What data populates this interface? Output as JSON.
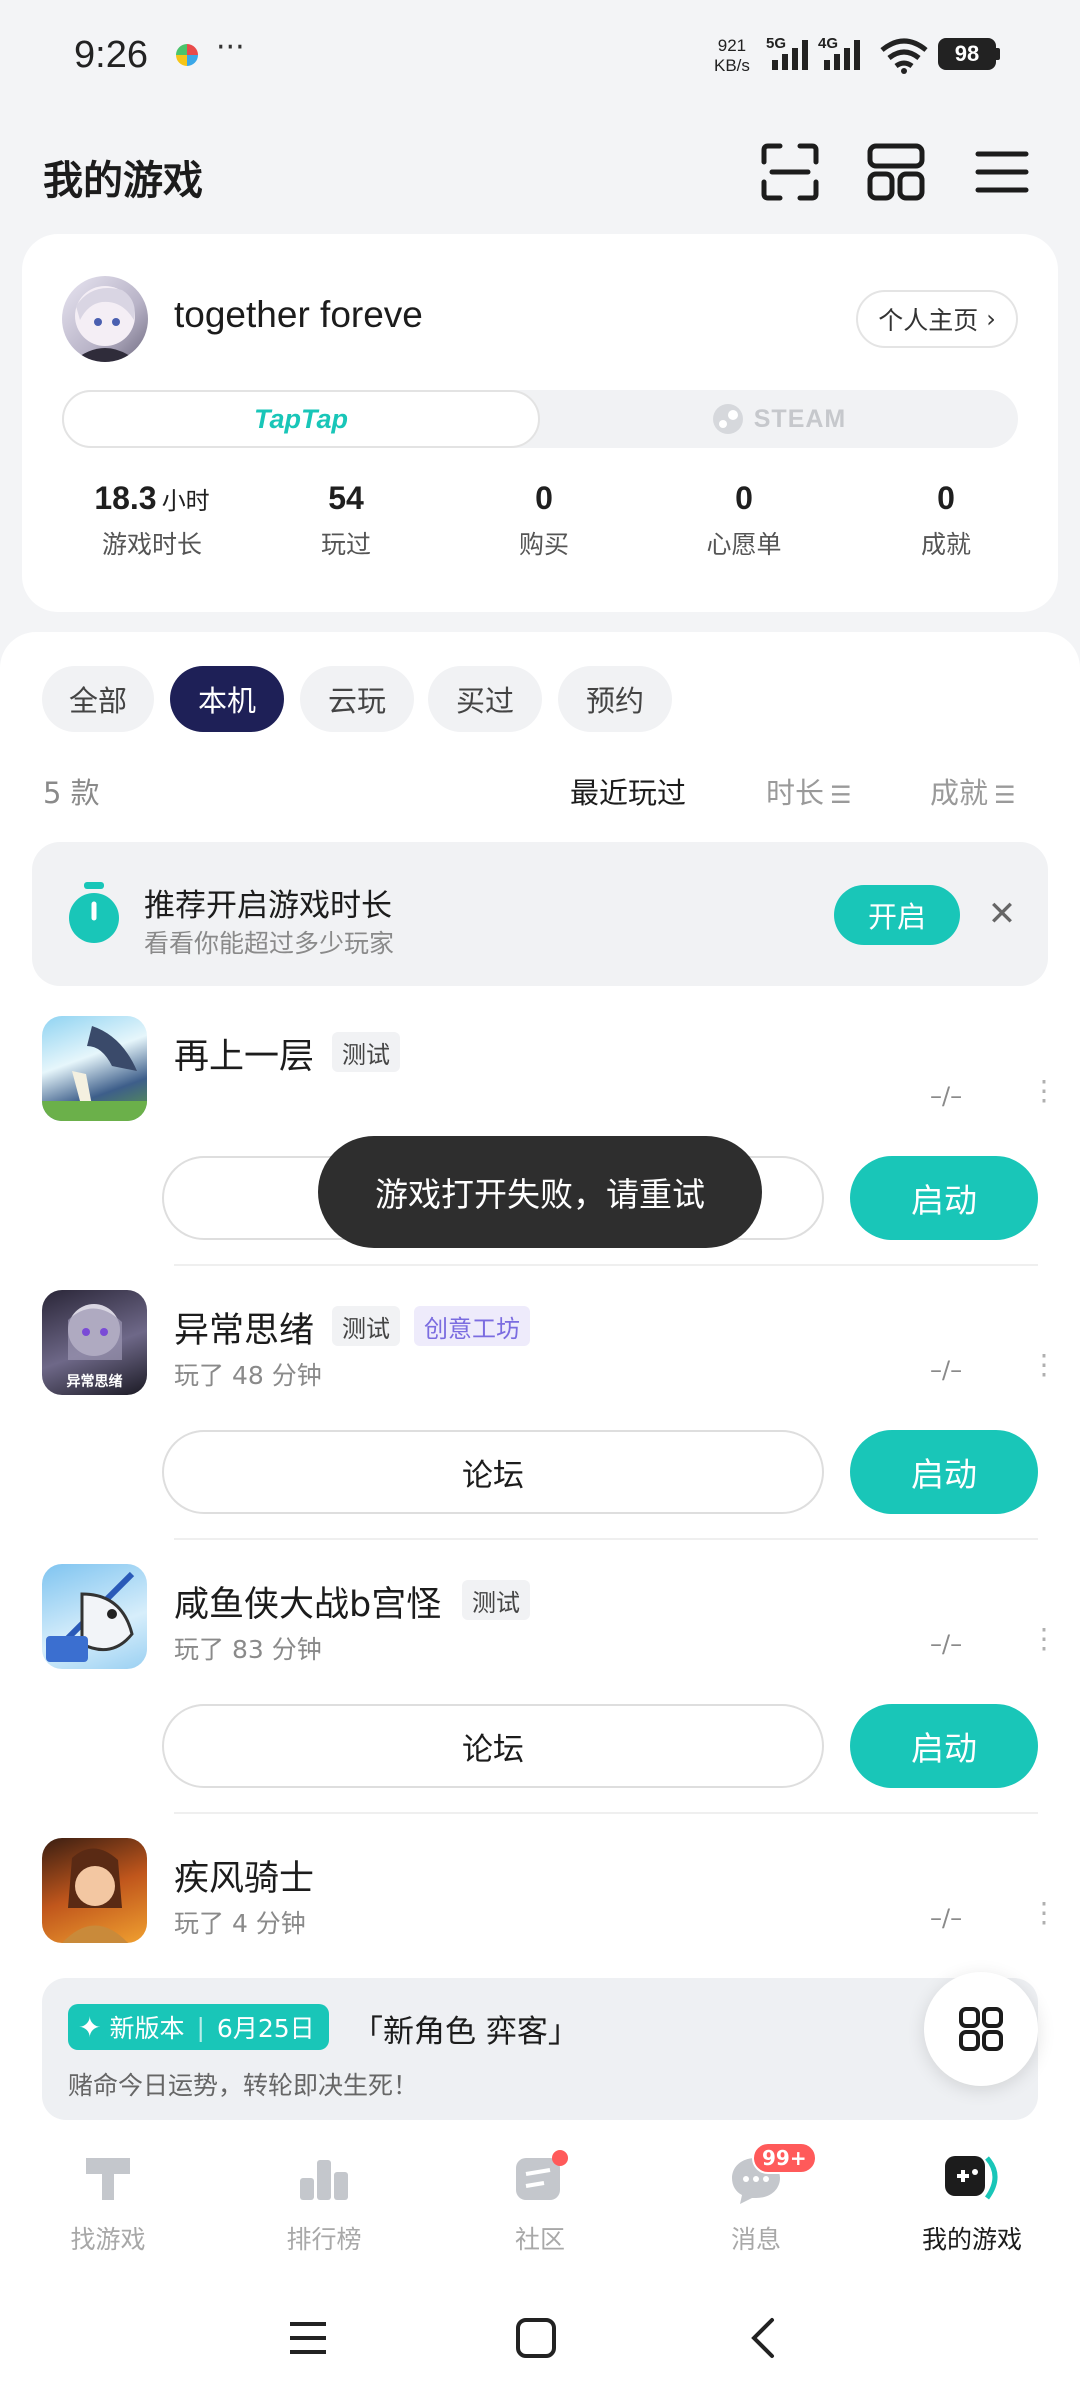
{
  "status": {
    "time": "9:26",
    "net_speed_top": "921",
    "net_speed_unit": "KB/s",
    "sig1": "5G",
    "sig2": "4G",
    "battery": "98"
  },
  "header": {
    "title": "我的游戏"
  },
  "profile": {
    "username": "together foreve",
    "home_button": "个人主页",
    "platforms": [
      "TapTap",
      "STEAM"
    ],
    "stats": [
      {
        "value": "18.3",
        "unit": "小时",
        "label": "游戏时长"
      },
      {
        "value": "54",
        "unit": "",
        "label": "玩过"
      },
      {
        "value": "0",
        "unit": "",
        "label": "购买"
      },
      {
        "value": "0",
        "unit": "",
        "label": "心愿单"
      },
      {
        "value": "0",
        "unit": "",
        "label": "成就"
      }
    ]
  },
  "filters": {
    "chips": [
      "全部",
      "本机",
      "云玩",
      "买过",
      "预约"
    ],
    "active": "本机"
  },
  "list_meta": {
    "count": "5 款",
    "sort_recent": "最近玩过",
    "sort_duration": "时长",
    "sort_achieve": "成就"
  },
  "banner": {
    "title": "推荐开启游戏时长",
    "subtitle": "看看你能超过多少玩家",
    "button": "开启"
  },
  "games": [
    {
      "name": "再上一层",
      "tags": [
        "测试"
      ],
      "playtime": "",
      "rating": "–/–",
      "forum": "论坛",
      "launch": "启动"
    },
    {
      "name": "异常思绪",
      "tags": [
        "测试",
        "创意工坊"
      ],
      "playtime": "玩了 48 分钟",
      "rating": "–/–",
      "forum": "论坛",
      "launch": "启动",
      "icon_text": "异常思绪"
    },
    {
      "name": "咸鱼侠大战b宫怪",
      "tags": [
        "测试"
      ],
      "playtime": "玩了 83 分钟",
      "rating": "–/–",
      "forum": "论坛",
      "launch": "启动"
    },
    {
      "name": "疾风骑士",
      "tags": [],
      "playtime": "玩了 4 分钟",
      "rating": "–/–"
    }
  ],
  "toast": "游戏打开失败，请重试",
  "update": {
    "badge": "新版本",
    "date": "6月25日",
    "title": "「新角色 弈客」",
    "subtitle": "赌命今日运势，转轮即决生死！"
  },
  "bottom_nav": [
    {
      "label": "找游戏"
    },
    {
      "label": "排行榜"
    },
    {
      "label": "社区"
    },
    {
      "label": "消息",
      "badge": "99+"
    },
    {
      "label": "我的游戏"
    }
  ],
  "colors": {
    "accent": "#19c6b8",
    "chip_active": "#1e2057"
  }
}
